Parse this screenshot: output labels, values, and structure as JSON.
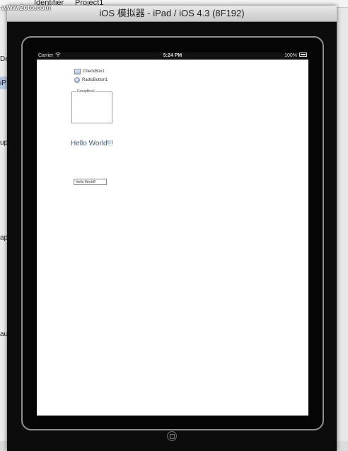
{
  "background": {
    "watermark": "www.2cto.com",
    "inspector_cells": [
      "Identifier",
      "Project1"
    ],
    "left_labels": [
      "De",
      "iP",
      "up",
      "ap",
      "au"
    ]
  },
  "simulator": {
    "title": "iOS 模拟器 - iPad / iOS 4.3 (8F192)"
  },
  "status_bar": {
    "carrier": "Carrier",
    "wifi_icon": "wifi-icon",
    "time": "5:24 PM",
    "battery": "100%"
  },
  "screen": {
    "checkbox_label": "CheckBox1",
    "radio_label": "RadioButton1",
    "groupbox_label": "GroupBox1",
    "hello_label": "Hello World!!!",
    "textfield_value": "Hello World!!"
  },
  "colors": {
    "label_text": "#3d5a7a",
    "device_bezel": "#050505",
    "screen_bg": "#ffffff"
  }
}
